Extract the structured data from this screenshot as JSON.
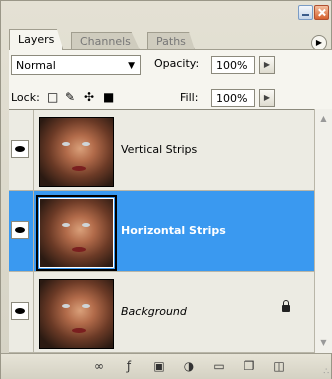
{
  "tabs": [
    "Layers",
    "Channels",
    "Paths"
  ],
  "options": {
    "blend_mode": "Normal",
    "opacity_label": "Opacity:",
    "opacity_value": "100%",
    "lock_label": "Lock:",
    "fill_label": "Fill:",
    "fill_value": "100%"
  },
  "layers": [
    {
      "name": "Vertical Strips",
      "selected": false,
      "visible": true
    },
    {
      "name": "Horizontal Strips",
      "selected": true,
      "visible": true
    },
    {
      "name": "Background",
      "selected": false,
      "visible": true,
      "locked": true
    }
  ],
  "bottom_icons": [
    "link-icon",
    "layer-style-icon",
    "add-mask-icon",
    "adjustment-layer-icon",
    "new-group-icon",
    "new-layer-icon",
    "trash-icon"
  ]
}
